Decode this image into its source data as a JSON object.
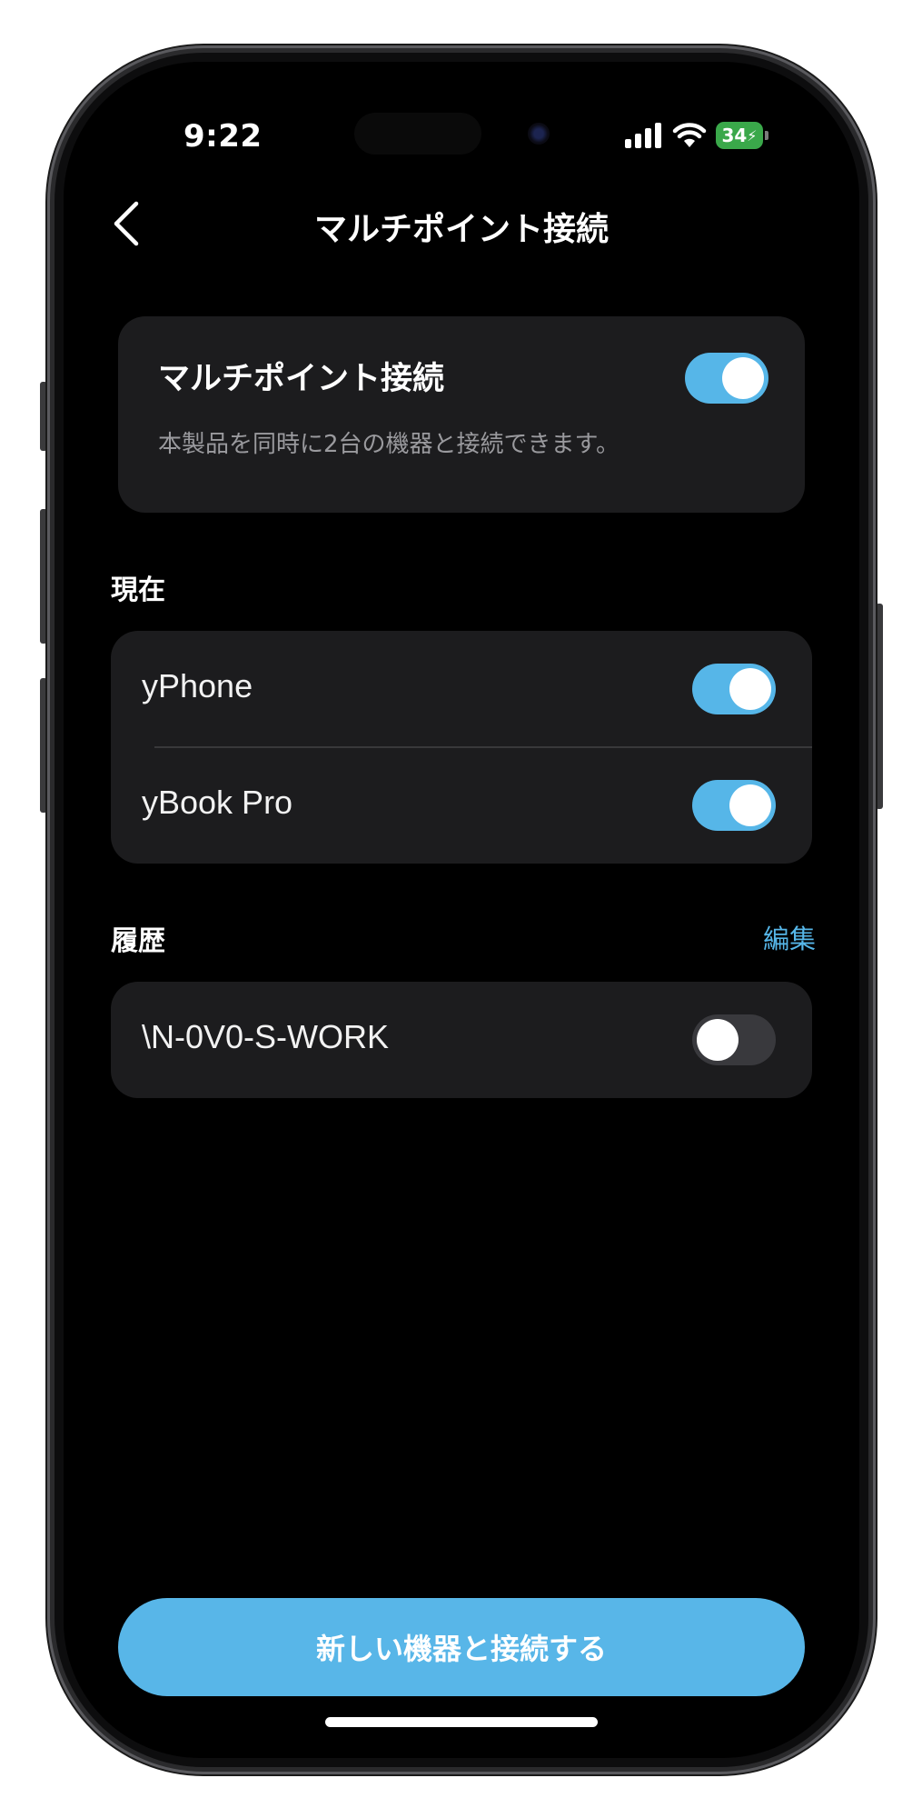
{
  "status_bar": {
    "time": "9:22",
    "battery": "34",
    "icons": [
      "signal-icon",
      "wifi-icon",
      "battery-charging-icon"
    ]
  },
  "nav": {
    "back_icon": "chevron-left-icon",
    "title": "マルチポイント接続"
  },
  "multipoint_card": {
    "title": "マルチポイント接続",
    "description": "本製品を同時に2台の機器と接続できます。",
    "enabled": true
  },
  "current_section": {
    "label": "現在",
    "devices": [
      {
        "name": "yPhone",
        "connected": true
      },
      {
        "name": "yBook Pro",
        "connected": true
      }
    ]
  },
  "history_section": {
    "label": "履歴",
    "edit_label": "編集",
    "devices": [
      {
        "name": "\\N-0V0-S-WORK",
        "connected": false
      }
    ]
  },
  "primary_button": {
    "label": "新しい機器と接続する"
  },
  "colors": {
    "accent": "#56b6e8",
    "card_bg": "#1c1c1e",
    "screen_bg": "#000000"
  }
}
